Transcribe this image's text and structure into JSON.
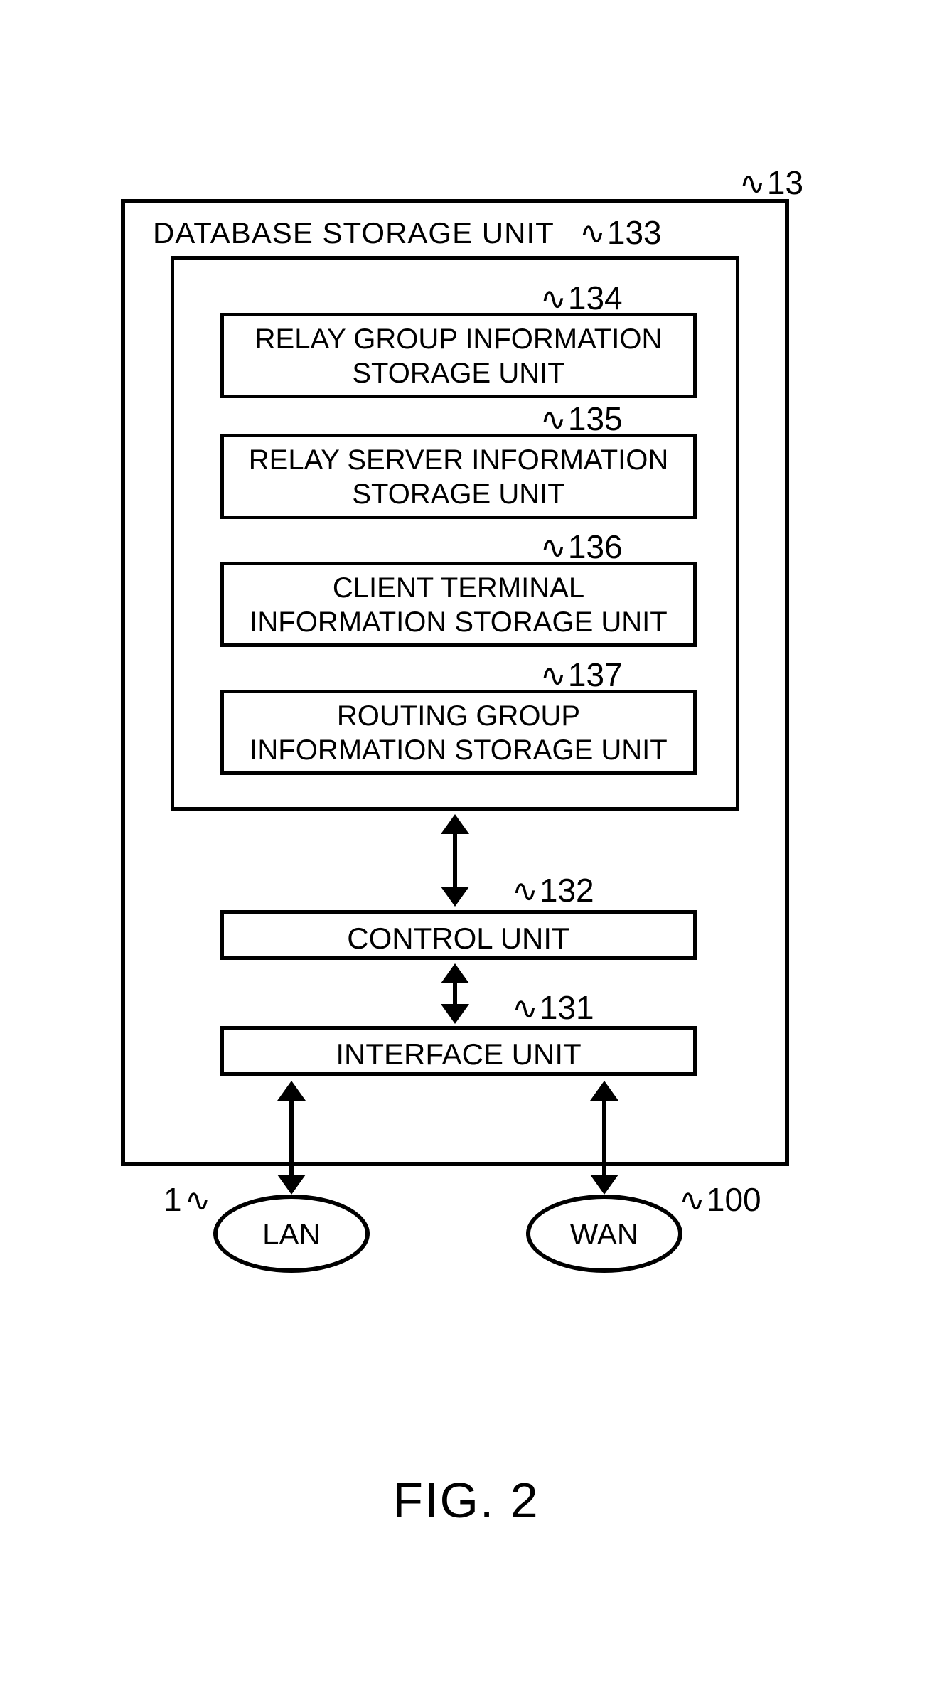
{
  "figure_caption": "FIG. 2",
  "refs": {
    "outer": "13",
    "db": "133",
    "u134": "134",
    "u135": "135",
    "u136": "136",
    "u137": "137",
    "control": "132",
    "interface": "131",
    "lan": "1",
    "wan": "100"
  },
  "labels": {
    "db_title": "DATABASE STORAGE UNIT",
    "u134_l1": "RELAY GROUP INFORMATION",
    "u134_l2": "STORAGE UNIT",
    "u135_l1": "RELAY SERVER INFORMATION",
    "u135_l2": "STORAGE UNIT",
    "u136_l1": "CLIENT TERMINAL",
    "u136_l2": "INFORMATION STORAGE UNIT",
    "u137_l1": "ROUTING GROUP",
    "u137_l2": "INFORMATION STORAGE UNIT",
    "control": "CONTROL UNIT",
    "interface": "INTERFACE UNIT",
    "lan": "LAN",
    "wan": "WAN"
  }
}
